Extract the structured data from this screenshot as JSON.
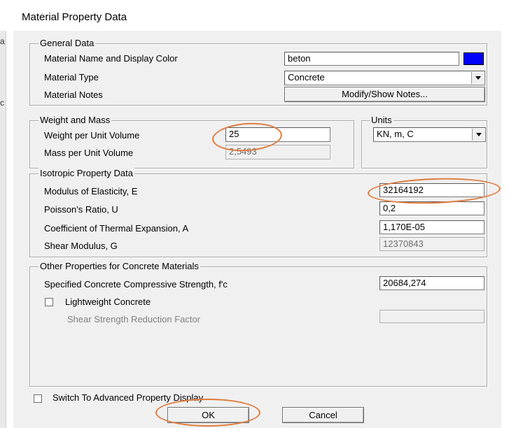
{
  "window": {
    "title": "Material Property Data"
  },
  "left_strip": {
    "glyph1": "a",
    "glyph2": "­",
    "glyph3": "c"
  },
  "general": {
    "legend": "General Data",
    "name_label": "Material Name and Display Color",
    "name_value": "beton",
    "color": "#0000ff",
    "type_label": "Material Type",
    "type_value": "Concrete",
    "notes_label": "Material Notes",
    "notes_button": "Modify/Show Notes..."
  },
  "weight": {
    "legend": "Weight and Mass",
    "weight_label": "Weight per Unit Volume",
    "weight_value": "25",
    "mass_label": "Mass per Unit Volume",
    "mass_value": "2,5493"
  },
  "units": {
    "legend": "Units",
    "value": "KN, m, C"
  },
  "isotropic": {
    "legend": "Isotropic Property Data",
    "e_label": "Modulus of Elasticity,  E",
    "e_value": "32164192",
    "u_label": "Poisson's Ratio,  U",
    "u_value": "0,2",
    "a_label": "Coefficient of Thermal Expansion,  A",
    "a_value": "1,170E-05",
    "g_label": "Shear Modulus,  G",
    "g_value": "12370843"
  },
  "concrete": {
    "legend": "Other Properties for Concrete Materials",
    "fc_label": "Specified Concrete Compressive Strength, f'c",
    "fc_value": "20684,274",
    "lw_label": "Lightweight Concrete",
    "ssrf_label": "Shear Strength Reduction Factor",
    "ssrf_value": ""
  },
  "advanced": {
    "label": "Switch To Advanced Property Display"
  },
  "buttons": {
    "ok": "OK",
    "cancel": "Cancel"
  },
  "annotation_color": "#e07a3a"
}
